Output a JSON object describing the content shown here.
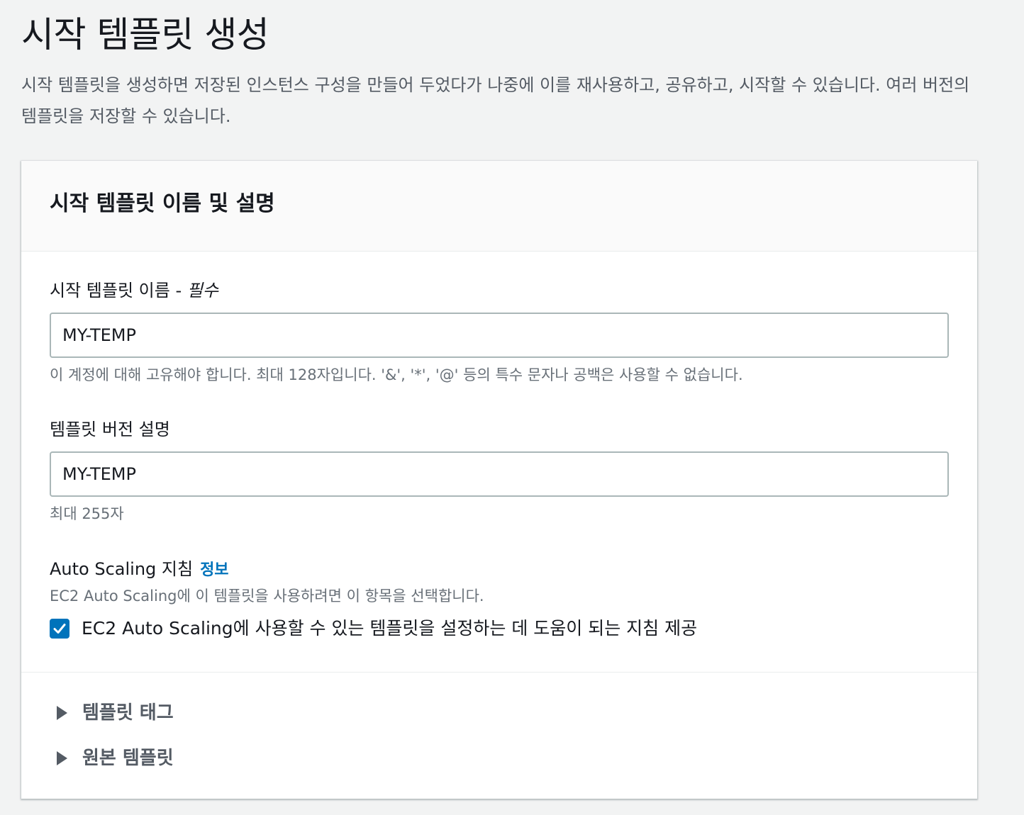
{
  "page": {
    "title": "시작 템플릿 생성",
    "description": "시작 템플릿을 생성하면 저장된 인스턴스 구성을 만들어 두었다가 나중에 이를 재사용하고, 공유하고, 시작할 수 있습니다. 여러 버전의 템플릿을 저장할 수 있습니다."
  },
  "panel": {
    "title": "시작 템플릿 이름 및 설명",
    "name_field": {
      "label": "시작 템플릿 이름 - ",
      "required": "필수",
      "value": "MY-TEMP",
      "hint": "이 계정에 대해 고유해야 합니다. 최대 128자입니다. '&', '*', '@' 등의 특수 문자나 공백은 사용할 수 없습니다."
    },
    "description_field": {
      "label": "템플릿 버전 설명",
      "value": "MY-TEMP",
      "hint": "최대 255자"
    },
    "autoscaling": {
      "label": "Auto Scaling 지침",
      "info_link": "정보",
      "hint": "EC2 Auto Scaling에 이 템플릿을 사용하려면 이 항목을 선택합니다.",
      "checkbox_label": "EC2 Auto Scaling에 사용할 수 있는 템플릿을 설정하는 데 도움이 되는 지침 제공",
      "checked": true
    },
    "expanders": [
      {
        "label": "템플릿 태그"
      },
      {
        "label": "원본 템플릿"
      }
    ]
  },
  "colors": {
    "accent": "#0073bb",
    "text": "#16191f",
    "muted": "#687078",
    "background": "#f2f3f3"
  }
}
